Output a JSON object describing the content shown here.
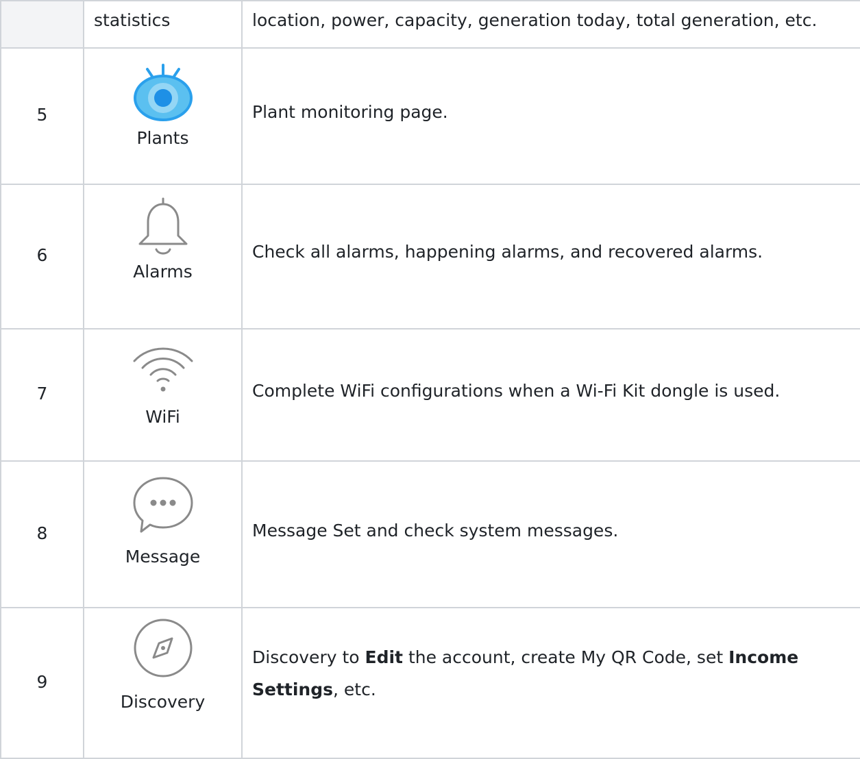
{
  "top_row": {
    "number": "",
    "name": "statistics",
    "description": "location, power, capacity, generation today, total generation, etc."
  },
  "rows": [
    {
      "number": "5",
      "label": "Plants",
      "icon": "plants-eye-icon",
      "description": "Plant monitoring page."
    },
    {
      "number": "6",
      "label": "Alarms",
      "icon": "bell-icon",
      "description": "Check all alarms, happening alarms, and recovered alarms."
    },
    {
      "number": "7",
      "label": "WiFi",
      "icon": "wifi-icon",
      "description": "Complete WiFi configurations when a Wi-Fi Kit dongle is used."
    },
    {
      "number": "8",
      "label": "Message",
      "icon": "message-bubble-icon",
      "description": "Message Set and check system messages."
    },
    {
      "number": "9",
      "label": "Discovery",
      "icon": "compass-icon",
      "description_parts": {
        "p1": "Discovery to ",
        "b1": "Edit",
        "p2": " the account, create My QR Code, set ",
        "b2": "Income Settings",
        "p3": ", etc."
      }
    }
  ],
  "colors": {
    "border": "#d0d4d9",
    "header_bg": "#f3f4f6",
    "plants_icon_fill": "#5bc0f0",
    "plants_icon_dark": "#1e90e6",
    "icon_gray": "#8a8a8a"
  }
}
